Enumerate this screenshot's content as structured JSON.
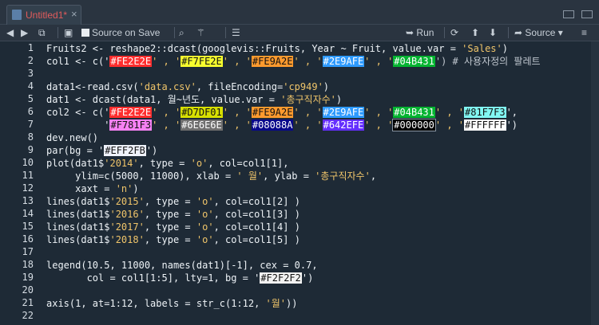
{
  "tab": {
    "title": "Untitled1*",
    "close": "×"
  },
  "toolbar": {
    "source_on_save": "Source on Save",
    "run": "Run",
    "source": "Source"
  },
  "line_numbers": [
    "1",
    "2",
    "3",
    "4",
    "5",
    "6",
    "7",
    "8",
    "9",
    "10",
    "11",
    "12",
    "13",
    "14",
    "15",
    "16",
    "17",
    "18",
    "19",
    "20",
    "21",
    "22"
  ],
  "code": {
    "l1": "Fruits2 <- reshape2::dcast(googlevis::Fruits, Year ~ Fruit, value.var = 'Sales')",
    "l2a": "col1 <- c('",
    "l2b": "' , '",
    "l2c": "') # 사용자정의 팔레트",
    "l4": "data1<-read.csv('data.csv', fileEncoding='cp949')",
    "l5": "dat1 <- dcast(data1, 월~년도, value.var = '총구직자수')",
    "l6a": "col2 <- c('",
    "l7a": "          '",
    "l8": "dev.new()",
    "l9a": "par(bg = '",
    "l9b": "')",
    "l10": "plot(dat1$'2014', type = 'o', col=col1[1],",
    "l11": "     ylim=c(5000, 11000), xlab = ' 월', ylab = '총구직자수',",
    "l12": "     xaxt = 'n')",
    "l13": "lines(dat1$'2015', type = 'o', col=col1[2] )",
    "l14": "lines(dat1$'2016', type = 'o', col=col1[3] )",
    "l15": "lines(dat1$'2017', type = 'o', col=col1[4] )",
    "l16": "lines(dat1$'2018', type = 'o', col=col1[5] )",
    "l18": "legend(10.5, 11000, names(dat1)[-1], cex = 0.7,",
    "l19a": "       col = col1[1:5], lty=1, bg = '",
    "l19b": "')",
    "l21": "axis(1, at=1:12, labels = str_c(1:12, '월'))"
  },
  "colors": {
    "c1": "#FE2E2E",
    "c2": "#F7FE2E",
    "c3": "#FE9A2E",
    "c4": "#2E9AFE",
    "c5": "#04B431",
    "c6": "#D7DF01",
    "c7": "#81F7F3",
    "c8": "#F781F3",
    "c9": "#6E6E6E",
    "c10": "#08088A",
    "c11": "#642EFE",
    "c12": "#000000",
    "c13": "#FFFFFF",
    "c14": "#EFF2FB",
    "c15": "#F2F2F2"
  },
  "theme": {
    "background": "#1e2a36",
    "string": "#f0c56a",
    "accent": "#e25b5b"
  }
}
